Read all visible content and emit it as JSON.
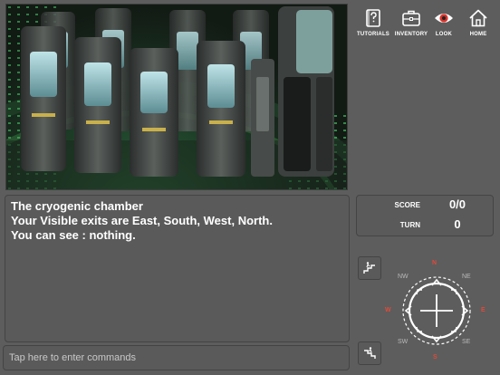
{
  "toolbar": {
    "tutorials_label": "TUTORIALS",
    "inventory_label": "INVENTORY",
    "look_label": "LOOK",
    "home_label": "HOME"
  },
  "output": {
    "lines": [
      "The cryogenic chamber",
      "Your Visible exits are East, South, West, North.",
      "You can see : nothing."
    ]
  },
  "score": {
    "score_label": "SCORE",
    "score_value": "0/0",
    "turn_label": "TURN",
    "turn_value": "0"
  },
  "command": {
    "placeholder": "Tap here to enter commands"
  },
  "compass": {
    "n": "N",
    "ne": "NE",
    "e": "E",
    "se": "SE",
    "s": "S",
    "sw": "SW",
    "w": "W",
    "nw": "NW"
  },
  "colors": {
    "background": "#5d5d5d",
    "cardinal": "#e04a3a",
    "ordinal": "#b9b9b9",
    "look_eye": "#d8322a"
  },
  "icons": {
    "tutorials": "book-question-icon",
    "inventory": "briefcase-icon",
    "look": "eye-icon",
    "home": "house-icon",
    "up": "stairs-up-icon",
    "down": "stairs-down-icon"
  }
}
